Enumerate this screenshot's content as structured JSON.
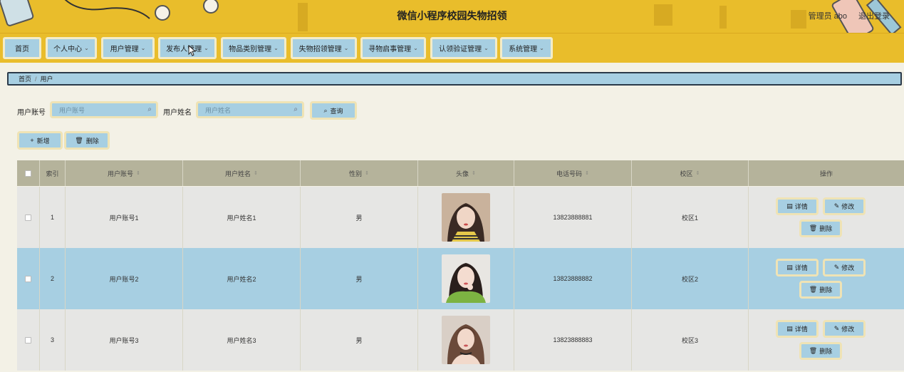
{
  "header": {
    "title": "微信小程序校园失物招领",
    "admin": "管理员 abo",
    "logout": "退出登录"
  },
  "nav": [
    {
      "label": "首页",
      "dropdown": false
    },
    {
      "label": "个人中心",
      "dropdown": true
    },
    {
      "label": "用户管理",
      "dropdown": true
    },
    {
      "label": "发布人管理",
      "dropdown": true
    },
    {
      "label": "物品类别管理",
      "dropdown": true
    },
    {
      "label": "失物招领管理",
      "dropdown": true
    },
    {
      "label": "寻物启事管理",
      "dropdown": true
    },
    {
      "label": "认领验证管理",
      "dropdown": true
    },
    {
      "label": "系统管理",
      "dropdown": true
    }
  ],
  "breadcrumb": {
    "home": "首页",
    "sep": "/",
    "current": "用户"
  },
  "search": {
    "account_label": "用户账号",
    "account_placeholder": "用户账号",
    "name_label": "用户姓名",
    "name_placeholder": "用户姓名",
    "query_label": "查询"
  },
  "actions": {
    "add": "新增",
    "delete": "删除"
  },
  "table": {
    "columns": [
      "索引",
      "用户账号",
      "用户姓名",
      "性别",
      "头像",
      "电话号码",
      "校区",
      "操作"
    ],
    "rows": [
      {
        "index": "1",
        "account": "用户账号1",
        "name": "用户姓名1",
        "gender": "男",
        "phone": "13823888881",
        "campus": "校区1"
      },
      {
        "index": "2",
        "account": "用户账号2",
        "name": "用户姓名2",
        "gender": "男",
        "phone": "13823888882",
        "campus": "校区2"
      },
      {
        "index": "3",
        "account": "用户账号3",
        "name": "用户姓名3",
        "gender": "男",
        "phone": "13823888883",
        "campus": "校区3"
      }
    ],
    "row_buttons": {
      "detail": "详情",
      "edit": "修改",
      "delete": "删除"
    }
  },
  "colors": {
    "header_bg": "#e9bd2b",
    "button_bg": "#a7cfe2",
    "table_header_bg": "#b5b39b",
    "row_odd_bg": "#e6e6e4",
    "row_selected_bg": "#a7cfe2"
  },
  "icons": [
    "search-icon",
    "plus-icon",
    "trash-icon",
    "detail-icon",
    "edit-icon",
    "chevron-down-icon",
    "sort-icon",
    "cursor-icon"
  ]
}
